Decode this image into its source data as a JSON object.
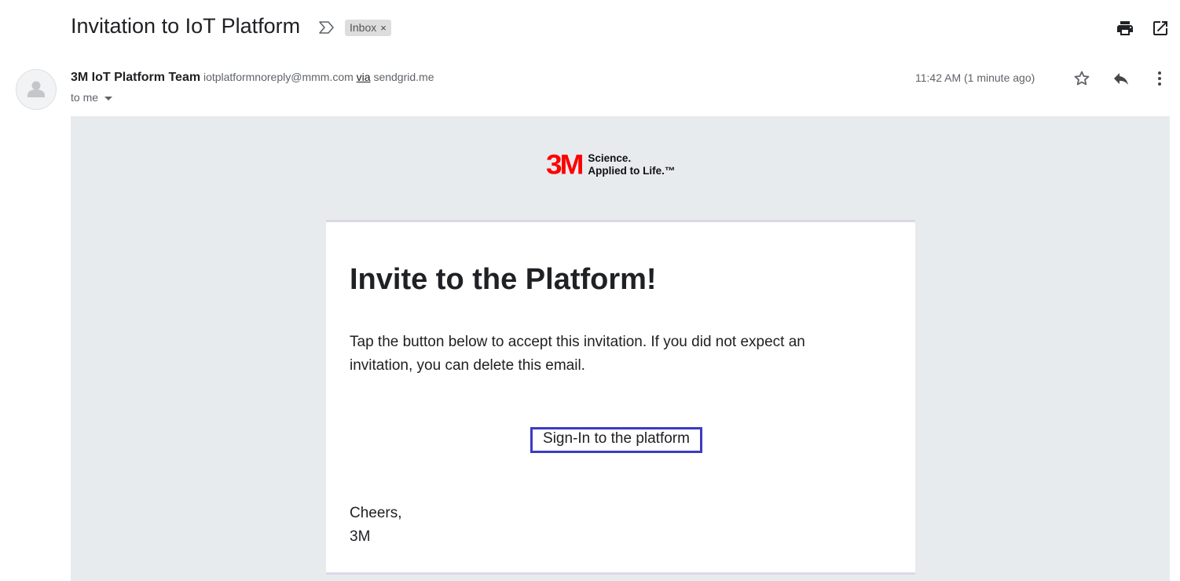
{
  "email": {
    "subject": "Invitation to IoT Platform",
    "label": "Inbox",
    "label_remove": "×",
    "sender_name": "3M IoT Platform Team",
    "sender_email": "iotplatformnoreply@mmm.com",
    "via_label": "via",
    "via_domain": "sendgrid.me",
    "recipient": "to me",
    "timestamp": "11:42 AM (1 minute ago)"
  },
  "icons": {
    "importance": "importance-marker-icon",
    "print": "print-icon",
    "open_new": "open-in-new-window-icon",
    "star": "star-icon",
    "reply": "reply-icon",
    "more": "more-vert-icon",
    "avatar": "person-avatar-icon"
  },
  "body": {
    "logo_mark": "3M",
    "logo_tagline_1": "Science.",
    "logo_tagline_2": "Applied to Life.™",
    "heading": "Invite to the Platform!",
    "message": "Tap the button below to accept this invitation. If you did not expect an invitation, you can delete this email.",
    "button_label": "Sign-In to the platform",
    "signoff_1": "Cheers,",
    "signoff_2": "3M"
  },
  "colors": {
    "brand_red": "#ff0000",
    "button_border": "#3b3bc4",
    "body_background": "#e8ebee"
  }
}
